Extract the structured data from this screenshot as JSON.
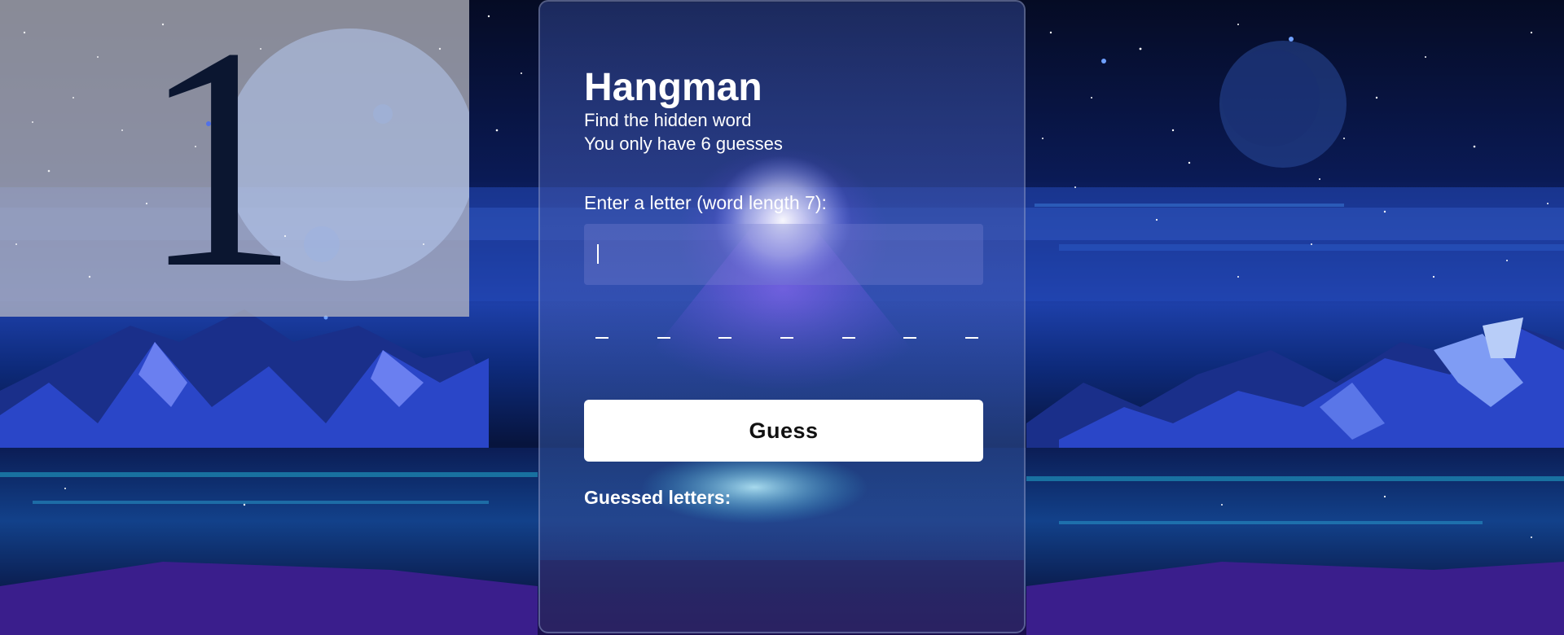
{
  "background": {
    "sky_color": "#0a1a55",
    "mountain_color": "#2a46c8",
    "water_color": "#1e8fb8"
  },
  "hangman": {
    "figure_glyph": "1"
  },
  "game": {
    "title": "Hangman",
    "subtitle_line1": "Find the hidden word",
    "subtitle_line2": "You only have 6 guesses",
    "prompt": "Enter a letter (word length 7):",
    "input_value": "",
    "word_length": 7,
    "slots": [
      "_",
      "_",
      "_",
      "_",
      "_",
      "_",
      "_"
    ],
    "guess_button_label": "Guess",
    "guessed_letters_label": "Guessed letters:",
    "guessed_letters": ""
  }
}
